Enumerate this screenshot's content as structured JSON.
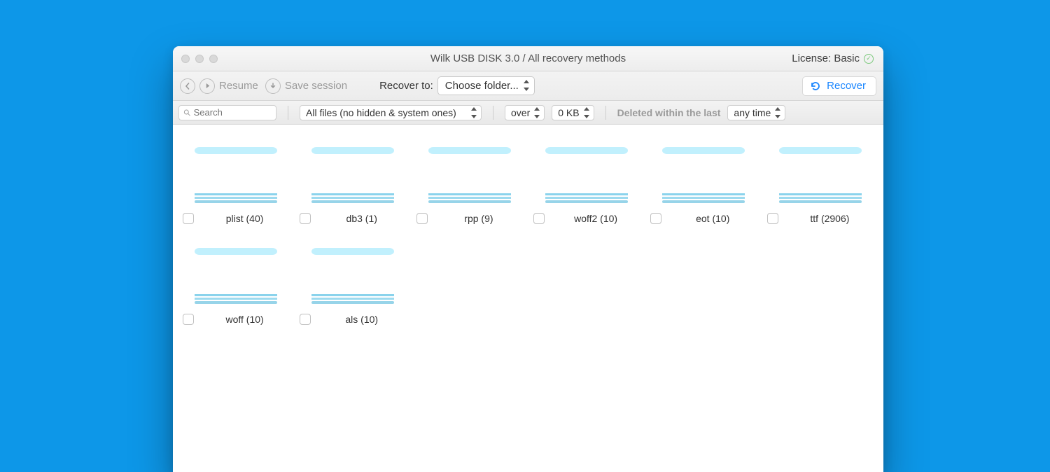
{
  "titlebar": {
    "title": "Wilk USB DISK 3.0 / All recovery methods",
    "license_label": "License: Basic"
  },
  "toolbar": {
    "resume_label": "Resume",
    "save_session_label": "Save session",
    "recover_to_label": "Recover to:",
    "folder_select": "Choose folder...",
    "recover_button": "Recover"
  },
  "filter": {
    "search_placeholder": "Search",
    "file_filter": "All files (no hidden & system ones)",
    "size_compare": "over",
    "size_value": "0 KB",
    "deleted_label": "Deleted within the last",
    "time_value": "any time"
  },
  "folders": [
    {
      "name": "plist",
      "count": 40
    },
    {
      "name": "db3",
      "count": 1
    },
    {
      "name": "rpp",
      "count": 9
    },
    {
      "name": "woff2",
      "count": 10
    },
    {
      "name": "eot",
      "count": 10
    },
    {
      "name": "ttf",
      "count": 2906
    },
    {
      "name": "woff",
      "count": 10
    },
    {
      "name": "als",
      "count": 10
    }
  ]
}
